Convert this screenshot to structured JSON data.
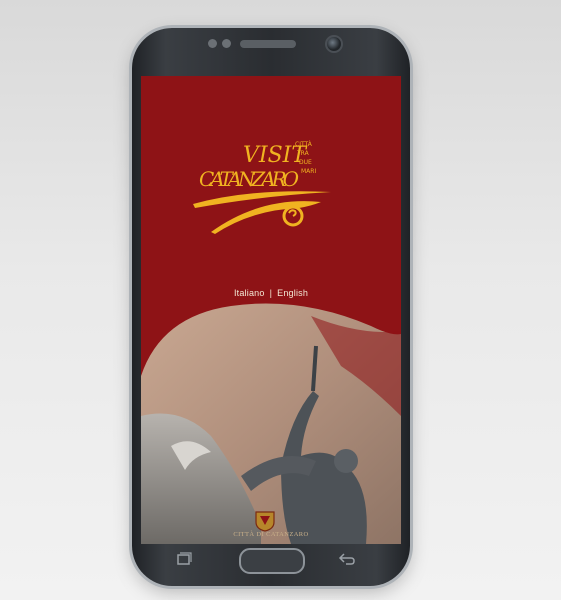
{
  "splash": {
    "logo_text": {
      "line1": "VISIT",
      "line2": "CATANZARO",
      "tagline": [
        "CITTÀ",
        "TRA",
        "DUE",
        "MARI"
      ]
    },
    "language_options": {
      "italiano": "Italiano",
      "separator": "|",
      "english": "English"
    },
    "footer": "CITTÀ DI CATANZARO"
  },
  "colors": {
    "background_red": "#8e1316",
    "logo_yellow": "#f0b321",
    "text_light": "#f3e7d4"
  },
  "device": {
    "nav": {
      "recent_icon": "recent-apps-icon",
      "home_icon": "home-button",
      "back_icon": "back-arrow-icon"
    }
  }
}
